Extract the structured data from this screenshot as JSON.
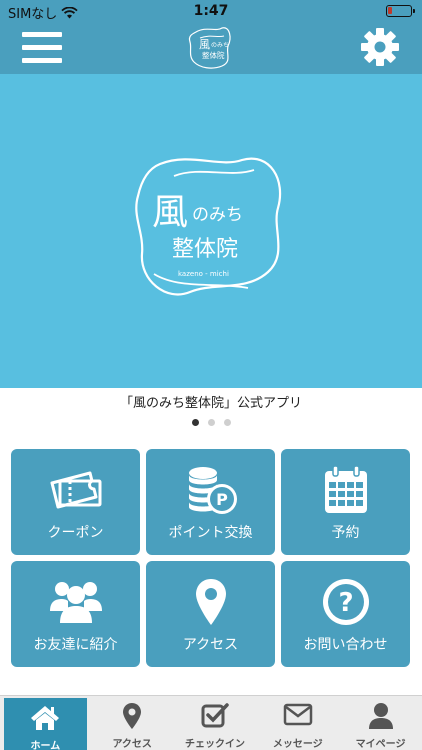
{
  "status_bar": {
    "carrier": "SIMなし",
    "time": "1:47"
  },
  "header": {
    "menu_icon": "hamburger-menu-icon",
    "settings_icon": "gear-icon"
  },
  "hero": {
    "logo_main": "風",
    "logo_sub": "のみち",
    "logo_clinic": "整体院",
    "logo_roman": "kazeno - michi"
  },
  "caption": "「風のみち整体院」公式アプリ",
  "pager": {
    "count": 3,
    "active": 0
  },
  "tiles": [
    {
      "label": "クーポン",
      "icon": "ticket-icon"
    },
    {
      "label": "ポイント交換",
      "icon": "coins-point-icon"
    },
    {
      "label": "予約",
      "icon": "calendar-icon"
    },
    {
      "label": "お友達に紹介",
      "icon": "users-icon"
    },
    {
      "label": "アクセス",
      "icon": "map-pin-icon"
    },
    {
      "label": "お問い合わせ",
      "icon": "question-icon"
    }
  ],
  "tabs": [
    {
      "label": "ホーム",
      "icon": "home-icon",
      "active": true
    },
    {
      "label": "アクセス",
      "icon": "map-pin-icon"
    },
    {
      "label": "チェックイン",
      "icon": "checkbox-icon"
    },
    {
      "label": "メッセージ",
      "icon": "envelope-icon"
    },
    {
      "label": "マイページ",
      "icon": "person-icon"
    }
  ],
  "colors": {
    "header": "#4a9fbe",
    "hero": "#58bfe0",
    "tile": "#4a9fbe",
    "active_tab": "#2f8fb0"
  }
}
